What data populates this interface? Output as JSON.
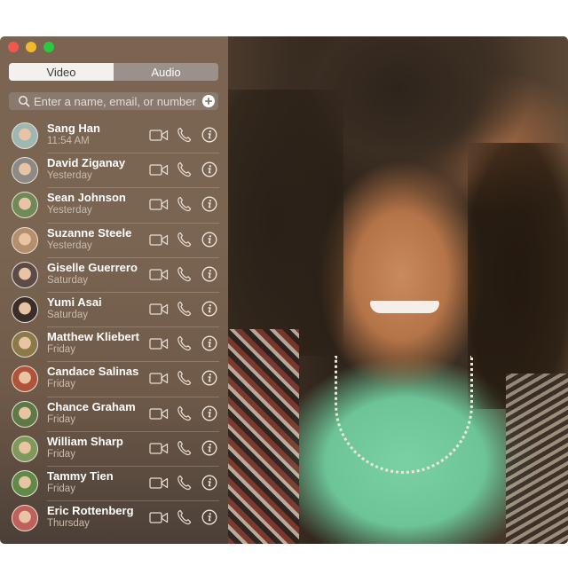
{
  "window": {
    "traffic_lights": [
      {
        "name": "close",
        "color": "#f0584e"
      },
      {
        "name": "minimize",
        "color": "#f3b92c"
      },
      {
        "name": "zoom",
        "color": "#2bc840"
      }
    ]
  },
  "tabs": [
    {
      "label": "Video",
      "selected": true
    },
    {
      "label": "Audio",
      "selected": false
    }
  ],
  "search": {
    "placeholder": "Enter a name, email, or number",
    "value": "",
    "icon": "search-icon",
    "add_icon": "add-icon"
  },
  "contacts": [
    {
      "name": "Sang Han",
      "time": "11:54 AM",
      "avatar_color": "#9fb7b3"
    },
    {
      "name": "David Ziganay",
      "time": "Yesterday",
      "avatar_color": "#8c8a86"
    },
    {
      "name": "Sean Johnson",
      "time": "Yesterday",
      "avatar_color": "#6f8a56"
    },
    {
      "name": "Suzanne Steele",
      "time": "Yesterday",
      "avatar_color": "#b58e6c"
    },
    {
      "name": "Giselle Guerrero",
      "time": "Saturday",
      "avatar_color": "#5a4a48"
    },
    {
      "name": "Yumi Asai",
      "time": "Saturday",
      "avatar_color": "#3a2e2a"
    },
    {
      "name": "Matthew Kliebert",
      "time": "Friday",
      "avatar_color": "#8a7a48"
    },
    {
      "name": "Candace Salinas",
      "time": "Friday",
      "avatar_color": "#b0533a"
    },
    {
      "name": "Chance Graham",
      "time": "Friday",
      "avatar_color": "#5d7a46"
    },
    {
      "name": "William Sharp",
      "time": "Friday",
      "avatar_color": "#7e9a5a"
    },
    {
      "name": "Tammy Tien",
      "time": "Friday",
      "avatar_color": "#5f8a48"
    },
    {
      "name": "Eric Rottenberg",
      "time": "Thursday",
      "avatar_color": "#c0605a"
    }
  ],
  "row_actions": [
    "video-call-icon",
    "audio-call-icon",
    "info-icon"
  ],
  "video_preview": {
    "description": "Smiling woman with curly hair, mint green top"
  }
}
